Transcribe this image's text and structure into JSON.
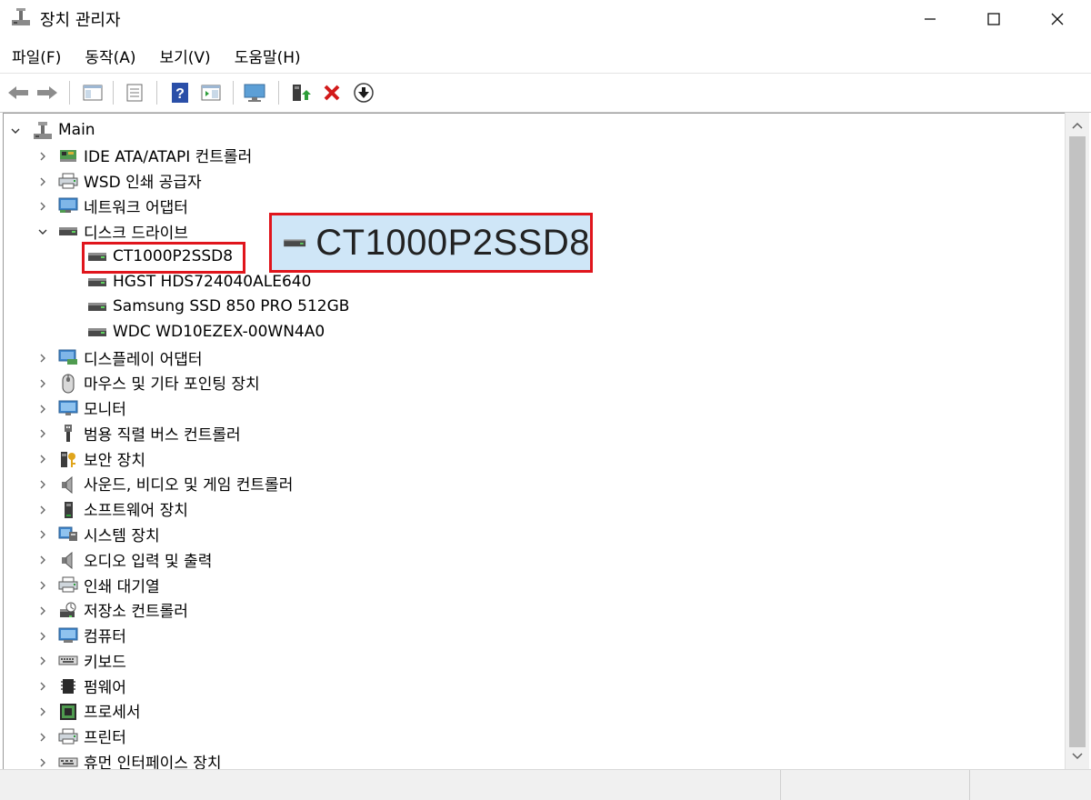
{
  "window": {
    "title": "장치 관리자",
    "buttons": {
      "minimize": "—",
      "maximize": "☐",
      "close": "✕"
    }
  },
  "menu": [
    "파일(F)",
    "동작(A)",
    "보기(V)",
    "도움말(H)"
  ],
  "toolbar": {
    "buttons": [
      "back-arrow-icon",
      "forward-arrow-icon",
      "show-hide-console-tree-icon",
      "properties-icon",
      "help-icon",
      "action-pane-icon",
      "monitor-icon",
      "update-driver-icon",
      "uninstall-device-icon",
      "disable-device-icon"
    ]
  },
  "tree": {
    "root": "Main",
    "categories": [
      {
        "label": "IDE ATA/ATAPI 컨트롤러",
        "icon": "ide-controller-icon",
        "expanded": false
      },
      {
        "label": "WSD 인쇄 공급자",
        "icon": "printer-icon",
        "expanded": false
      },
      {
        "label": "네트워크 어댑터",
        "icon": "network-adapter-icon",
        "expanded": false
      },
      {
        "label": "디스크 드라이브",
        "icon": "disk-drive-icon",
        "expanded": true,
        "children": [
          "CT1000P2SSD8",
          "HGST HDS724040ALE640",
          "Samsung SSD 850 PRO 512GB",
          "WDC WD10EZEX-00WN4A0"
        ]
      },
      {
        "label": "디스플레이 어댑터",
        "icon": "display-adapter-icon",
        "expanded": false
      },
      {
        "label": "마우스 및 기타 포인팅 장치",
        "icon": "mouse-icon",
        "expanded": false
      },
      {
        "label": "모니터",
        "icon": "monitor-icon",
        "expanded": false
      },
      {
        "label": "범용 직렬 버스 컨트롤러",
        "icon": "usb-icon",
        "expanded": false
      },
      {
        "label": "보안 장치",
        "icon": "security-device-icon",
        "expanded": false
      },
      {
        "label": "사운드, 비디오 및 게임 컨트롤러",
        "icon": "speaker-icon",
        "expanded": false
      },
      {
        "label": "소프트웨어 장치",
        "icon": "software-device-icon",
        "expanded": false
      },
      {
        "label": "시스템 장치",
        "icon": "system-device-icon",
        "expanded": false
      },
      {
        "label": "오디오 입력 및 출력",
        "icon": "speaker-icon",
        "expanded": false
      },
      {
        "label": "인쇄 대기열",
        "icon": "printer-icon",
        "expanded": false
      },
      {
        "label": "저장소 컨트롤러",
        "icon": "storage-controller-icon",
        "expanded": false
      },
      {
        "label": "컴퓨터",
        "icon": "computer-icon",
        "expanded": false
      },
      {
        "label": "키보드",
        "icon": "keyboard-icon",
        "expanded": false
      },
      {
        "label": "펌웨어",
        "icon": "firmware-icon",
        "expanded": false
      },
      {
        "label": "프로세서",
        "icon": "processor-icon",
        "expanded": false
      },
      {
        "label": "프린터",
        "icon": "printer-icon",
        "expanded": false
      },
      {
        "label": "휴먼 인터페이스 장치",
        "icon": "hid-icon",
        "expanded": false
      }
    ]
  },
  "callout": {
    "text": "CT1000P2SSD8",
    "color": "#e0151c",
    "background": "#cfe6f7"
  },
  "colors": {
    "highlight_border": "#e0151c",
    "icon_blue": "#2f7fc7",
    "icon_green": "#2e9e3a"
  }
}
